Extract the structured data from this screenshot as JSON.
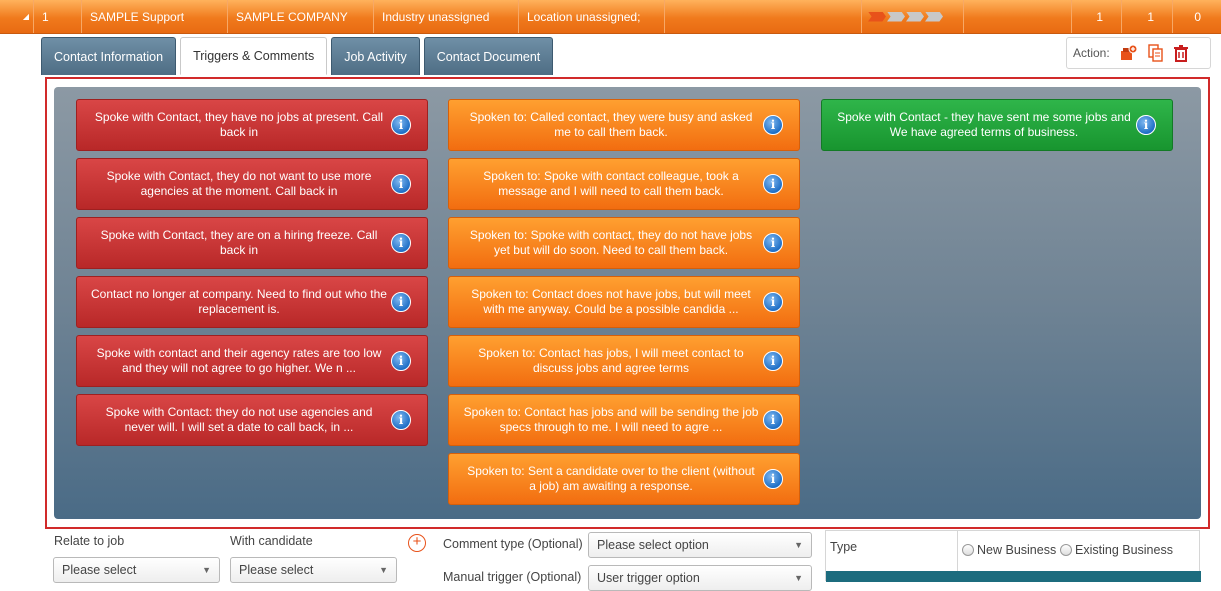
{
  "toprow": {
    "expand_glyph": "◢",
    "num": "1",
    "name": "SAMPLE Support",
    "company": "SAMPLE COMPANY",
    "industry": "Industry unassigned",
    "location": "Location unassigned;",
    "stage_progress": "1 of 4",
    "count1": "1",
    "count2": "1",
    "count3": "0"
  },
  "tabs": [
    {
      "label": "Contact Information"
    },
    {
      "label": "Triggers & Comments"
    },
    {
      "label": "Job Activity"
    },
    {
      "label": "Contact Document"
    }
  ],
  "action": {
    "label": "Action:"
  },
  "triggers": {
    "red": [
      "Spoke with Contact, they have no jobs at present. Call back in",
      "Spoke with Contact, they do not want to use more agencies at the moment. Call back in",
      "Spoke with Contact, they are on a hiring freeze. Call back in",
      "Contact no longer at company. Need to find out who the replacement is.",
      "Spoke with contact and their agency rates are too low and they will not agree to go higher. We n ...",
      "Spoke with Contact: they do not use agencies and never will. I will set a date to call back, in ..."
    ],
    "orange": [
      "Spoken to: Called contact, they were busy and asked me to call them back.",
      "Spoken to: Spoke with contact colleague, took a message and I will need to call them back.",
      "Spoken to: Spoke with contact, they do not have jobs yet but will do soon. Need to call them back.",
      "Spoken to: Contact does not have jobs, but will meet with me anyway. Could be a possible candida ...",
      "Spoken to: Contact has jobs, I will meet contact to discuss jobs and agree terms",
      "Spoken to: Contact has jobs and will be sending the job specs through to me. I will need to agre ...",
      "Spoken to: Sent a candidate over to the client (without a job) am awaiting a response."
    ],
    "green": [
      "Spoke with Contact - they have sent me some jobs and We have agreed terms of business."
    ],
    "info_glyph": "i"
  },
  "form": {
    "relate_label": "Relate to job",
    "relate_value": "Please select",
    "candidate_label": "With candidate",
    "candidate_value": "Please select",
    "plus_glyph": "+",
    "comment_type_label": "Comment type (Optional)",
    "comment_type_value": "Please select option",
    "manual_trigger_label": "Manual trigger (Optional)",
    "manual_trigger_value": "User trigger option",
    "type_label": "Type",
    "radio_new": "New Business",
    "radio_existing": "Existing Business"
  },
  "colors": {
    "accent_orange": "#f07a1c",
    "trigger_red": "#c83232",
    "trigger_orange": "#f7861e",
    "trigger_green": "#22a53c",
    "frame_red": "#d12a2a"
  },
  "icons": [
    "expand-icon",
    "stage-chevron-icon",
    "add-action-icon",
    "copy-icon",
    "delete-icon",
    "info-icon",
    "add-candidate-icon",
    "dropdown-arrow-icon"
  ]
}
